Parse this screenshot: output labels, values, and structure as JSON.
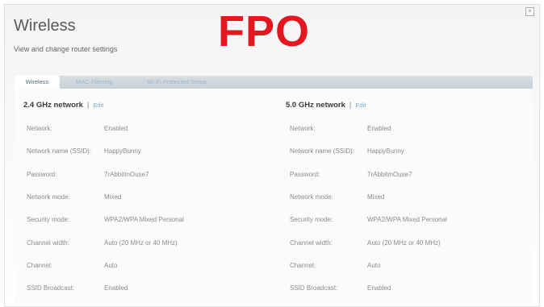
{
  "header": {
    "title": "Wireless",
    "subtitle": "View and change router settings",
    "overlay": "FPO",
    "close_glyph": "×"
  },
  "tabs": [
    {
      "label": "Wireless",
      "active": true
    },
    {
      "label": "MAC Filtering",
      "active": false
    },
    {
      "label": "Wi-Fi Protected Setup",
      "active": false
    }
  ],
  "networks": {
    "left": {
      "heading": "2.4 GHz network",
      "separator": "|",
      "edit_label": "Edit",
      "rows": [
        {
          "label": "Network:",
          "value": "Enabled"
        },
        {
          "label": "Network name (SSID):",
          "value": "HappyBunny"
        },
        {
          "label": "Password:",
          "value": "7rAbbitmOuse7"
        },
        {
          "label": "Network mode:",
          "value": "Mixed"
        },
        {
          "label": "Security mode:",
          "value": "WPA2/WPA Mixed Personal"
        },
        {
          "label": "Channel width:",
          "value": "Auto (20 MHz or 40 MHz)"
        },
        {
          "label": "Channel:",
          "value": "Auto"
        },
        {
          "label": "SSID Broadcast:",
          "value": "Enabled"
        }
      ]
    },
    "right": {
      "heading": "5.0 GHz network",
      "separator": "|",
      "edit_label": "Edit",
      "rows": [
        {
          "label": "Network:",
          "value": "Enabled"
        },
        {
          "label": "Network name (SSID):",
          "value": "HappyBunny"
        },
        {
          "label": "Password:",
          "value": "7rAbbitmOuse7"
        },
        {
          "label": "Network mode:",
          "value": "Mixed"
        },
        {
          "label": "Security mode:",
          "value": "WPA2/WPA Mixed Personal"
        },
        {
          "label": "Channel width:",
          "value": "Auto (20 MHz or 40 MHz)"
        },
        {
          "label": "Channel:",
          "value": "Auto"
        },
        {
          "label": "SSID Broadcast:",
          "value": "Enabled"
        }
      ]
    }
  }
}
